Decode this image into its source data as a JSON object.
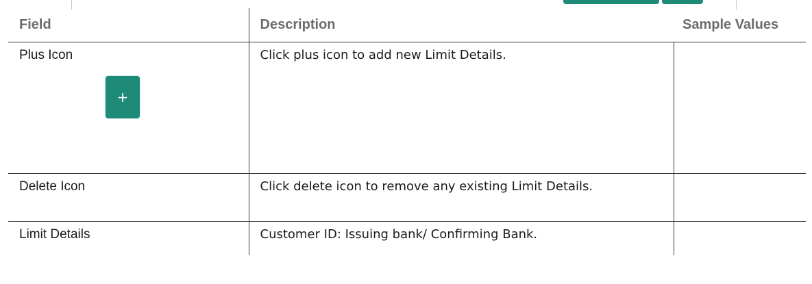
{
  "table": {
    "headers": [
      "Field",
      "Description",
      "Sample Values"
    ],
    "rows": [
      {
        "field": "Plus Icon",
        "description": "Click plus icon to add new Limit Details.",
        "sample": "",
        "icon_glyph": "+",
        "icon_name": "plus-icon"
      },
      {
        "field": "Delete Icon",
        "description": "Click delete icon to remove any existing Limit Details.",
        "sample": ""
      },
      {
        "field": "Limit Details",
        "description": "Customer ID: Issuing bank/ Confirming Bank.",
        "sample": ""
      }
    ]
  },
  "colors": {
    "accent": "#1e8a78",
    "header_text": "#6b6b6b",
    "border": "#333333"
  }
}
